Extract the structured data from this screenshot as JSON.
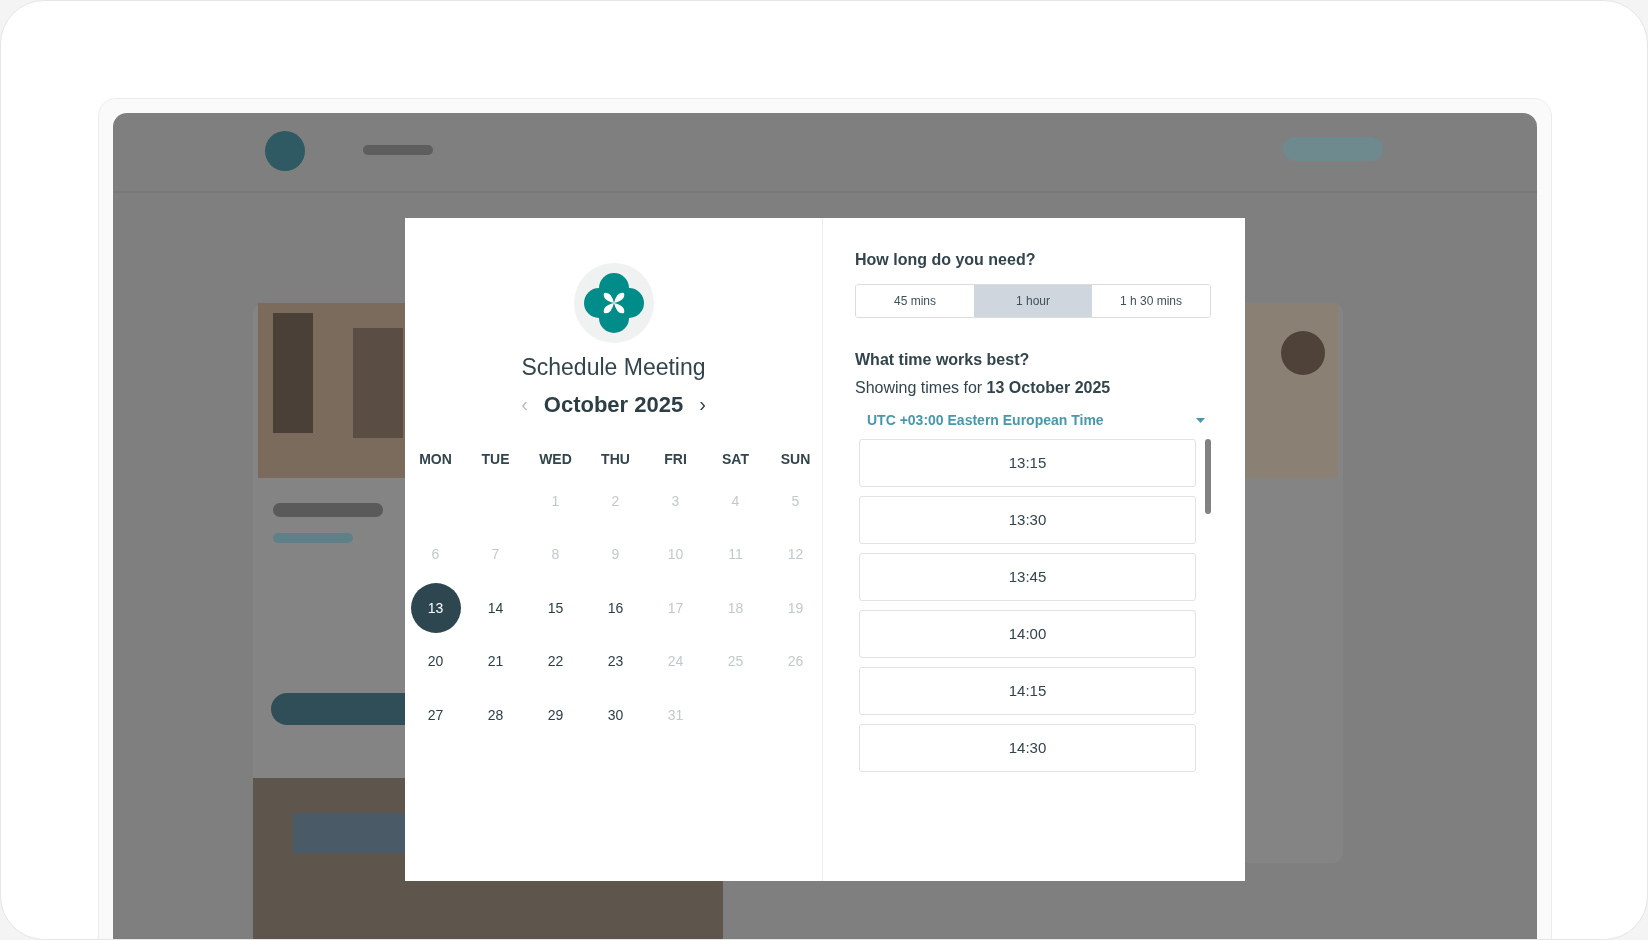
{
  "calendar": {
    "title": "Schedule Meeting",
    "month": "October 2025",
    "prev": "‹",
    "next": "›",
    "weekdays": [
      "MON",
      "TUE",
      "WED",
      "THU",
      "FRI",
      "SAT",
      "SUN"
    ],
    "weeks": [
      [
        {
          "label": "1",
          "available": false,
          "selected": false
        },
        {
          "label": "2",
          "available": false,
          "selected": false
        },
        {
          "label": "3",
          "available": false,
          "selected": false
        },
        {
          "label": "4",
          "available": false,
          "selected": false
        },
        {
          "label": "5",
          "available": false,
          "selected": false
        }
      ],
      [
        {
          "label": "6",
          "available": false,
          "selected": false
        },
        {
          "label": "7",
          "available": false,
          "selected": false
        },
        {
          "label": "8",
          "available": false,
          "selected": false
        },
        {
          "label": "9",
          "available": false,
          "selected": false
        },
        {
          "label": "10",
          "available": false,
          "selected": false
        },
        {
          "label": "11",
          "available": false,
          "selected": false
        },
        {
          "label": "12",
          "available": false,
          "selected": false
        }
      ],
      [
        {
          "label": "13",
          "available": true,
          "selected": true
        },
        {
          "label": "14",
          "available": true,
          "selected": false
        },
        {
          "label": "15",
          "available": true,
          "selected": false
        },
        {
          "label": "16",
          "available": true,
          "selected": false
        },
        {
          "label": "17",
          "available": false,
          "selected": false
        },
        {
          "label": "18",
          "available": false,
          "selected": false
        },
        {
          "label": "19",
          "available": false,
          "selected": false
        }
      ],
      [
        {
          "label": "20",
          "available": true,
          "selected": false
        },
        {
          "label": "21",
          "available": true,
          "selected": false
        },
        {
          "label": "22",
          "available": true,
          "selected": false
        },
        {
          "label": "23",
          "available": true,
          "selected": false
        },
        {
          "label": "24",
          "available": false,
          "selected": false
        },
        {
          "label": "25",
          "available": false,
          "selected": false
        },
        {
          "label": "26",
          "available": false,
          "selected": false
        }
      ],
      [
        {
          "label": "27",
          "available": true,
          "selected": false
        },
        {
          "label": "28",
          "available": true,
          "selected": false
        },
        {
          "label": "29",
          "available": true,
          "selected": false
        },
        {
          "label": "30",
          "available": true,
          "selected": false
        },
        {
          "label": "31",
          "available": false,
          "selected": false
        }
      ]
    ]
  },
  "duration": {
    "question": "How long do you need?",
    "options": [
      {
        "label": "45 mins",
        "selected": false
      },
      {
        "label": "1 hour",
        "selected": true
      },
      {
        "label": "1 h 30 mins",
        "selected": false
      }
    ]
  },
  "times": {
    "question": "What time works best?",
    "showing": "Showing times for **13 October 2025**",
    "timezone": "UTC +03:00 Eastern European Time",
    "slots": [
      "13:15",
      "13:30",
      "13:45",
      "14:00",
      "14:15",
      "14:30"
    ]
  }
}
